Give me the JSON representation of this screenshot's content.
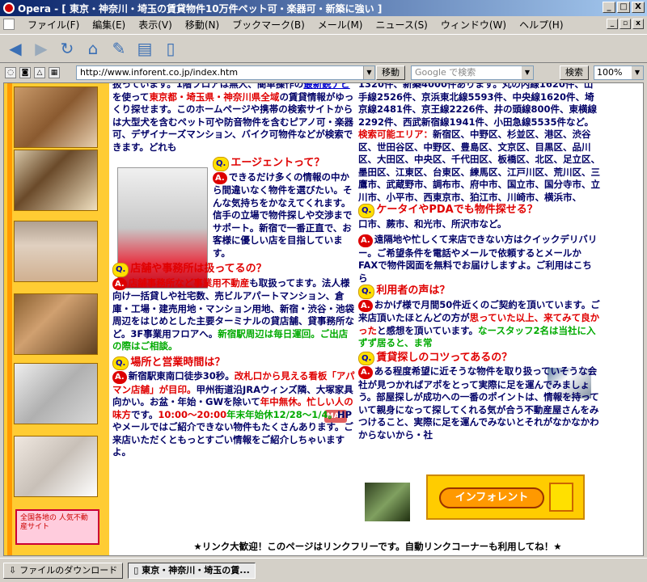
{
  "window": {
    "title": "Opera - [ 東京・神奈川・埼玉の賃貸物件10万件ペット可・楽器可・新築に強い ]",
    "min": "_",
    "max": "□",
    "close": "X"
  },
  "menu": [
    "ファイル(F)",
    "編集(E)",
    "表示(V)",
    "移動(N)",
    "ブックマーク(B)",
    "メール(M)",
    "ニュース(S)",
    "ウィンドウ(W)",
    "ヘルプ(H)"
  ],
  "address": {
    "url": "http://www.inforent.co.jp/index.htm",
    "go_label": "移動"
  },
  "search": {
    "placeholder": "Google で検索",
    "button": "検索"
  },
  "zoom": "100%",
  "left": {
    "banner_text": "全国各地の 人気不動産サイト"
  },
  "content": {
    "left_intro": "扱っています。1階フロアは無人、簡単操作の",
    "left_link1": "最新鋭ナビ",
    "left_intro2": "を使って",
    "left_red1": "東京都・埼玉県・神奈川県全域",
    "left_intro3": "の賃貸情報がゆっくり探せます。このホームページや携帯の検索サイトからは大型犬を含むペット可や防音物件を含むピアノ可・楽器可、デザイナーズマンション、バイク可物件などが検索できます。どれも",
    "q1": "エージェントって？",
    "a1": "できるだけ多くの情報の中から間違いなく物件を選びたい。そんな気持ちをかなえてくれます。信手の立場で物件探しや交渉までサポート。新宿で一番正直で、お客様に優しい店を目指しています。",
    "q2": "店舗や事務所は扱ってるの？",
    "a2_red": "店舗事務所など事業用不動産",
    "a2": "も取扱ってます。法人様向け一括貸しや社宅数、売ビルアパートマンション、倉庫・工場・建売用地・マンション用地、新宿・渋谷・池袋周辺をはじめとした主要ターミナルの貸店舗、貸事務所など。3F事業用フロアへ。",
    "a2_grn": "新宿駅周辺は毎日運回。ご出店の際はご相談。",
    "q3": "場所と営業時間は？",
    "map": "MAP",
    "a3_start": "新宿駅東南口徒歩30秒。",
    "a3_red": "改札口から見える看板「アパマン店舗」が目印。",
    "a3_mid": "甲州街道沿JRAウィンズ隣、大塚家具向かい。お盆・年始・GWを除いて",
    "a3_red2": "年中無休。忙しい人の味方",
    "a3_end": "です。",
    "a3_hours": "10:00〜20:00",
    "a3_grn": "年末年始休12/28〜1/4。",
    "a3_tail": "HPやメールではご紹介できない物件もたくさんあります。ご来店いただくともっとすごい情報をご紹介しちゃいますよ。",
    "right_1": "1320件、新築4000件あります。丸の内線1620件、山手線2526件、京浜東北線5593件、中央線1620件、埼京線2481件、京王線2226件、井の頭線800件、東横線2292件、西武新宿線1941件、小田急線5535件など。",
    "right_red": "検索可能エリア：",
    "right_2": "新宿区、中野区、杉並区、港区、渋谷区、世田谷区、中野区、豊島区、文京区、目黒区、品川区、大田区、中央区、千代田区、板橋区、北区、足立区、墨田区、江東区、台東区、練馬区、江戸川区、荒川区、三鷹市、武蔵野市、調布市、府中市、国立市、国分寺市、立川市、小平市、西東京市、狛江市、川崎市、横浜市、",
    "q4": "ケータイやPDAでも物件探せる？",
    "right_3": "口市、蕨市、和光市、所沢市など。",
    "a4": "遠隔地や忙しくて来店できない方はクイックデリバリー。ご希望条件を電話やメールで依頼するとメールかFAXで物件図面を無料でお届けしますよ。ご利用はこちら",
    "q5": "利用者の声は？",
    "a5": "おかげ様で月間50件近くのご契約を頂いています。ご来店頂いたほとんどの方が",
    "a5_red": "思っていた以上、来てみて良かった",
    "a5_end": "と感想を頂いています。",
    "a5_grn": "なースタッフ2名は当社に入ずず居ると、ま常",
    "q6": "賃貸探しのコツってあるの？",
    "a6": "ある程度希望に近そうな物件を取り扱っていそうな会社が見つかればアポをとって実際に足を運んでみましょう。部屋探しが成功への一番のポイントは、情報を持っていて親身になって探してくれる気が合う不動産屋さんをみつけること、実際に足を運んでみないとそれがなかなかわからないから・社",
    "inforent_label": "インフォレント",
    "footer": "★リンク大歓迎！このページはリンクフリーです。自動リンクコーナーも利用してね！★"
  },
  "taskbar": {
    "downloads": "ファイルのダウンロード",
    "tab": "東京・神奈川・埼玉の賃..."
  }
}
